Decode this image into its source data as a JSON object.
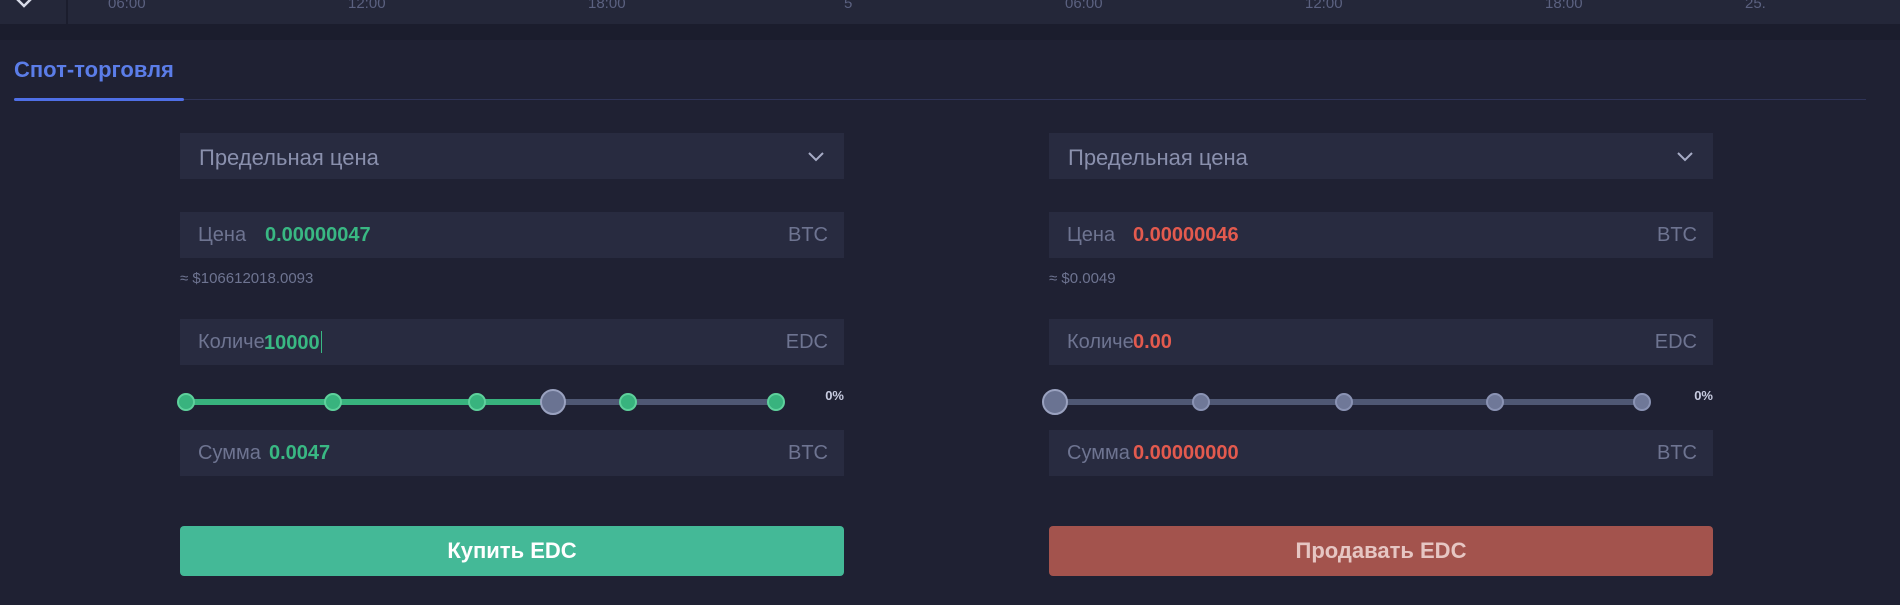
{
  "axis_ticks": [
    "06:00",
    "12:00",
    "18:00",
    "5",
    "06:00",
    "12:00",
    "18:00",
    "25."
  ],
  "tab": {
    "label": "Спот-торговля"
  },
  "buy": {
    "order_type": "Предельная цена",
    "price": {
      "label": "Цена",
      "value": "0.00000047",
      "unit": "BTC"
    },
    "approx": "≈ $106612018.0093",
    "qty": {
      "label": "Количе",
      "value": "10000",
      "unit": "EDC"
    },
    "slider": {
      "level": 0.5,
      "percent": "0%"
    },
    "sum": {
      "label": "Сумма",
      "value": "0.0047",
      "unit": "BTC"
    },
    "button": "Купить EDC"
  },
  "sell": {
    "order_type": "Предельная цена",
    "price": {
      "label": "Цена",
      "value": "0.00000046",
      "unit": "BTC"
    },
    "approx": "≈ $0.0049",
    "qty": {
      "label": "Количе",
      "value": "0.00",
      "unit": "EDC"
    },
    "slider": {
      "level": 0,
      "percent": "0%"
    },
    "sum": {
      "label": "Сумма",
      "value": "0.00000000",
      "unit": "BTC"
    },
    "button": "Продавать EDC"
  },
  "colors": {
    "buy": "#44b997",
    "sell": "#a3534d",
    "accent": "#4f6fe6"
  },
  "icons": {
    "expand": "chevron-down-icon",
    "select": "chevron-down-icon"
  }
}
